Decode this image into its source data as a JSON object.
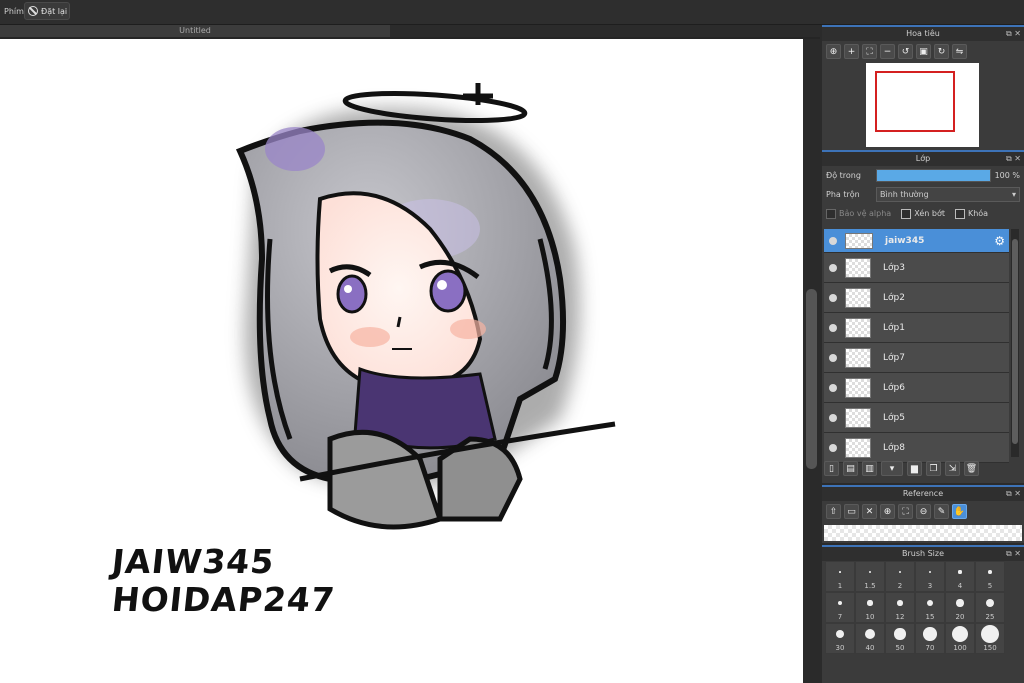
{
  "toolbar": {
    "label": "Phím",
    "reset_label": "Đặt lại"
  },
  "document": {
    "tab_title": "Untitled"
  },
  "canvas": {
    "watermark_line1": "JAIW345",
    "watermark_line2": "HOIDAP247"
  },
  "navigator": {
    "title": "Hoa tiêu"
  },
  "layers_panel": {
    "title": "Lớp",
    "opacity_label": "Độ trong",
    "opacity_value": "100 %",
    "opacity_fraction": 1.0,
    "blend_label": "Pha trộn",
    "blend_value": "Bình thường",
    "protect_alpha": "Bảo vệ alpha",
    "clipping": "Xén bớt",
    "lock": "Khóa",
    "layers": [
      {
        "name": "jaiw345",
        "selected": true
      },
      {
        "name": "Lớp3"
      },
      {
        "name": "Lớp2"
      },
      {
        "name": "Lớp1"
      },
      {
        "name": "Lớp7"
      },
      {
        "name": "Lớp6"
      },
      {
        "name": "Lớp5"
      },
      {
        "name": "Lớp8"
      }
    ]
  },
  "reference": {
    "title": "Reference"
  },
  "brush_size": {
    "title": "Brush Size",
    "sizes": [
      "1",
      "1.5",
      "2",
      "3",
      "4",
      "5",
      "7",
      "10",
      "12",
      "15",
      "20",
      "25",
      "30",
      "40",
      "50",
      "70",
      "100",
      "150"
    ]
  },
  "colors": {
    "accent": "#4a8fd8",
    "nav_frame": "#d42020",
    "opacity_bar": "#5aa9e6"
  }
}
